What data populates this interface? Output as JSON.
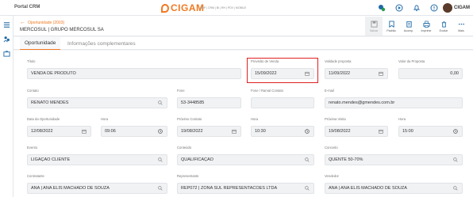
{
  "topbar": {
    "portal_title": "Portal CRM",
    "brand": "CIGAM",
    "brand_sub": "ERP | CRM | BI | RH | PDV | MOBILE",
    "user": "CIGAM"
  },
  "header": {
    "opp_label": "Oportunidade (2003)",
    "company": "MERCOSUL | GRUPO MERCOSUL SA"
  },
  "actions": [
    {
      "label": "Salvar",
      "icon": "save-icon"
    },
    {
      "label": "Padrão",
      "icon": "star-icon"
    },
    {
      "label": "Acomp.",
      "icon": "clipboard-icon"
    },
    {
      "label": "Imprimir",
      "icon": "print-icon"
    },
    {
      "label": "Excluir",
      "icon": "trash-icon"
    },
    {
      "label": "Mais",
      "icon": "more-icon"
    }
  ],
  "tabs": [
    {
      "label": "Oportunidade"
    },
    {
      "label": "Informações complementares"
    }
  ],
  "form": {
    "titulo": {
      "label": "Título",
      "value": "VENDA DE PRODUTO"
    },
    "previsao": {
      "label": "Previsão de Venda",
      "value": "15/09/2022"
    },
    "validade": {
      "label": "Validade proposta",
      "value": "11/09/2022"
    },
    "valor": {
      "label": "Valor da Proposta",
      "value": "0,00"
    },
    "contato": {
      "label": "Contato",
      "value": "RENATO MENDES"
    },
    "fone": {
      "label": "Fone",
      "value": "53-3448585"
    },
    "ramal": {
      "label": "Fone / Ramal Contato",
      "value": ""
    },
    "email": {
      "label": "E-mail",
      "value": "renato.mendes@gmendes.com.br"
    },
    "data_op": {
      "label": "Data da Oportunidade",
      "value": "12/08/2022"
    },
    "hora1": {
      "label": "Hora",
      "value": "09:06"
    },
    "prox_contato": {
      "label": "Próximo Contato",
      "value": "19/08/2022"
    },
    "hora2": {
      "label": "Hora",
      "value": "10:30"
    },
    "prox_visita": {
      "label": "Próxima Visita",
      "value": "19/08/2022"
    },
    "hora3": {
      "label": "Hora",
      "value": "15:00"
    },
    "evento": {
      "label": "Evento",
      "value": "LIGAÇÃO CLIENTE"
    },
    "conteudo": {
      "label": "Conteúdo",
      "value": "QUALIFICAÇÃO"
    },
    "conceito": {
      "label": "Conceito",
      "value": "QUENTE 50-70%"
    },
    "contratante": {
      "label": "Contratante",
      "value": "ANA | ANA ELIS MACHADO DE SOUZA"
    },
    "representante": {
      "label": "Representante",
      "value": "REP072 | ZONA SUL REPRESENTACOES LTDA"
    },
    "vendedor": {
      "label": "Vendedor",
      "value": "ANA | ANA ELIS MACHADO DE SOUZA"
    }
  }
}
